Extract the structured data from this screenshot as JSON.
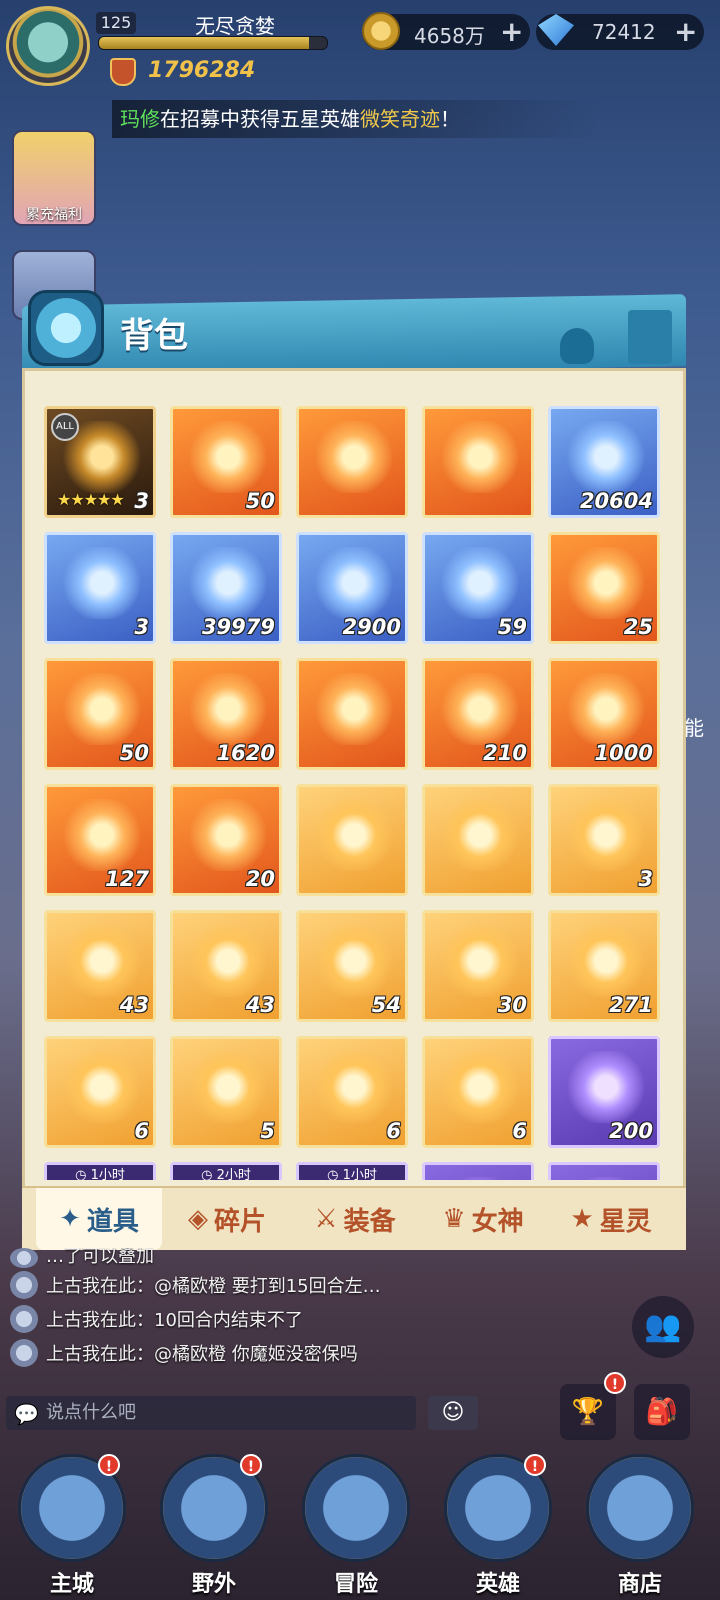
{
  "player": {
    "level": "125",
    "name": "无尽贪婪",
    "exp_fraction": 0.92,
    "power": "1796284"
  },
  "resources": {
    "coins": "4658万",
    "gems": "72412",
    "plus": "+"
  },
  "broadcast": {
    "name": "玛修",
    "middle": "在招募中获得五星英雄",
    "hero": "微笑奇迹",
    "end": "！"
  },
  "side": {
    "recharge_label": "累充福利"
  },
  "edge_text": "能",
  "backpack": {
    "title": "背包",
    "items": [
      {
        "qty": "3",
        "color": "brown",
        "icon": "golden-mask-icon",
        "badge": "ALL",
        "stars": "★★★★★"
      },
      {
        "qty": "50",
        "color": "orange",
        "icon": "treasure-chest-icon"
      },
      {
        "qty": "",
        "color": "orange",
        "icon": "peach-fruit-icon"
      },
      {
        "qty": "",
        "color": "orange",
        "icon": "crystal-frame-icon"
      },
      {
        "qty": "20604",
        "color": "blue",
        "icon": "blue-crystal-icon"
      },
      {
        "qty": "3",
        "color": "blue",
        "icon": "blue-fruit-icon"
      },
      {
        "qty": "39979",
        "color": "blue",
        "icon": "herb-leaf-icon"
      },
      {
        "qty": "2900",
        "color": "blue",
        "icon": "scroll-banner-icon"
      },
      {
        "qty": "59",
        "color": "blue",
        "icon": "spyglass-icon"
      },
      {
        "qty": "25",
        "color": "orange",
        "icon": "orb-frame-icon"
      },
      {
        "qty": "50",
        "color": "orange",
        "icon": "golden-chest-icon"
      },
      {
        "qty": "1620",
        "color": "orange",
        "icon": "dark-ore-icon"
      },
      {
        "qty": "",
        "color": "orange",
        "icon": "blue-gem-icon"
      },
      {
        "qty": "210",
        "color": "orange",
        "icon": "purple-cube-icon"
      },
      {
        "qty": "1000",
        "color": "orange",
        "icon": "star-crystal-icon"
      },
      {
        "qty": "127",
        "color": "orange",
        "icon": "green-spyglass-icon"
      },
      {
        "qty": "20",
        "color": "orange",
        "icon": "rainbow-gem-icon"
      },
      {
        "qty": "",
        "color": "gold",
        "icon": "card-frame-icon"
      },
      {
        "qty": "",
        "color": "gold",
        "icon": "card-back-icon"
      },
      {
        "qty": "3",
        "color": "gold",
        "icon": "red-card-icon"
      },
      {
        "qty": "43",
        "color": "gold",
        "icon": "red-compass-icon"
      },
      {
        "qty": "43",
        "color": "gold",
        "icon": "gold-compass-icon"
      },
      {
        "qty": "54",
        "color": "gold",
        "icon": "ship-wheel-icon"
      },
      {
        "qty": "30",
        "color": "gold",
        "icon": "crystal-shards-icon"
      },
      {
        "qty": "271",
        "color": "gold",
        "icon": "purple-spyglass-icon"
      },
      {
        "qty": "6",
        "color": "gold",
        "icon": "purple-flame-icon"
      },
      {
        "qty": "5",
        "color": "gold",
        "icon": "magic-scroll-icon"
      },
      {
        "qty": "6",
        "color": "gold",
        "icon": "rainbow-crystal-icon"
      },
      {
        "qty": "6",
        "color": "gold",
        "icon": "rolled-scroll-icon"
      },
      {
        "qty": "200",
        "color": "purple",
        "icon": "gold-armor-card-icon"
      },
      {
        "qty": "",
        "color": "purple",
        "icon": "timer-item-icon",
        "timer": "1小时"
      },
      {
        "qty": "",
        "color": "purple",
        "icon": "timer-item-icon",
        "timer": "2小时"
      },
      {
        "qty": "",
        "color": "purple",
        "icon": "timer-item-icon",
        "timer": "1小时"
      },
      {
        "qty": "",
        "color": "purple",
        "icon": "item-icon"
      },
      {
        "qty": "",
        "color": "purple",
        "icon": "item-icon"
      }
    ],
    "tabs": [
      {
        "label": "道具",
        "icon": "✦",
        "active": true
      },
      {
        "label": "碎片",
        "icon": "◈",
        "active": false
      },
      {
        "label": "装备",
        "icon": "⚔",
        "active": false
      },
      {
        "label": "女神",
        "icon": "♛",
        "active": false
      },
      {
        "label": "星灵",
        "icon": "★",
        "active": false
      }
    ]
  },
  "chat": {
    "partial_line": "…了可以叠加",
    "messages": [
      {
        "sender": "上古我在此",
        "text": "：@橘欧橙 要打到15回合左…"
      },
      {
        "sender": "上古我在此",
        "text": "：10回合内结束不了"
      },
      {
        "sender": "上古我在此",
        "text": "：@橘欧橙 你魔姬没密保吗"
      }
    ],
    "placeholder": "说点什么吧",
    "alert": "!"
  },
  "nav": [
    {
      "label": "主城",
      "alert": true
    },
    {
      "label": "野外",
      "alert": true
    },
    {
      "label": "冒险",
      "alert": false
    },
    {
      "label": "英雄",
      "alert": true
    },
    {
      "label": "商店",
      "alert": false
    }
  ]
}
